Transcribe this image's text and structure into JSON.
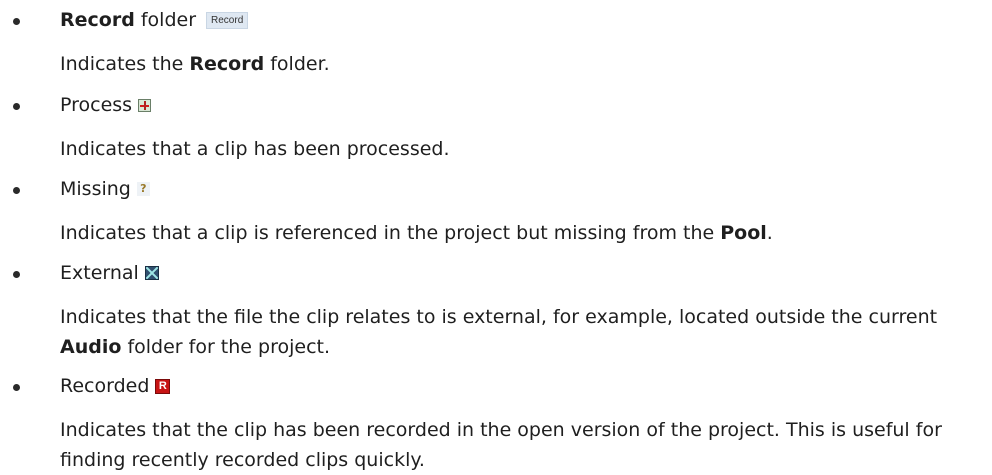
{
  "items": [
    {
      "title_bold": "Record",
      "title_rest": " folder",
      "icon": "record-folder-icon",
      "icon_text": "Record",
      "desc_pre": "Indicates the ",
      "desc_bold": "Record",
      "desc_post": " folder."
    },
    {
      "title": "Process",
      "icon": "process-icon",
      "desc": "Indicates that a clip has been processed."
    },
    {
      "title": "Missing",
      "icon": "missing-icon",
      "icon_text": "?",
      "desc_pre": "Indicates that a clip is referenced in the project but missing from the ",
      "desc_bold": "Pool",
      "desc_post": "."
    },
    {
      "title": "External",
      "icon": "external-icon",
      "desc_pre": "Indicates that the file the clip relates to is external, for example, located outside the current ",
      "desc_bold": "Audio",
      "desc_post": " folder for the project."
    },
    {
      "title": "Recorded",
      "icon": "recorded-icon",
      "icon_text": "R",
      "desc": "Indicates that the clip has been recorded in the open version of the project. This is useful for finding recently recorded clips quickly."
    }
  ]
}
